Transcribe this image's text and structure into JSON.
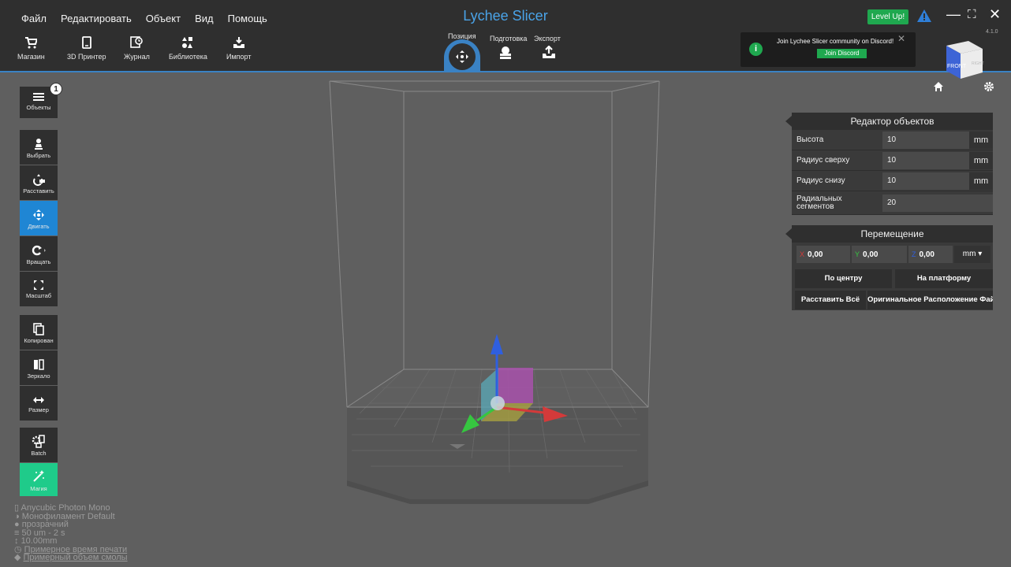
{
  "menu": [
    "Файл",
    "Редактировать",
    "Объект",
    "Вид",
    "Помощь"
  ],
  "app_title": "Lychee Slicer",
  "toolbar": [
    {
      "label": "Магазин",
      "icon": "cart-icon"
    },
    {
      "label": "3D Принтер",
      "icon": "printer-icon"
    },
    {
      "label": "Журнал",
      "icon": "journal-icon"
    },
    {
      "label": "Библиотека",
      "icon": "library-icon"
    },
    {
      "label": "Импорт",
      "icon": "import-icon"
    }
  ],
  "tabs": [
    {
      "label": "Позиция",
      "active": true,
      "icon": "move-icon"
    },
    {
      "label": "Подготовка",
      "active": false,
      "icon": "support-icon"
    },
    {
      "label": "Экспорт",
      "active": false,
      "icon": "export-icon"
    }
  ],
  "level_up": "Level Up!",
  "version": "4.1.0",
  "toast": {
    "message": "Join Lychee Slicer community on Discord!",
    "button": "Join Discord",
    "close": "✕"
  },
  "viewcube": {
    "front": "FRONT",
    "right": "RIGHT"
  },
  "left_tools": [
    {
      "label": "Объекты",
      "icon": "list-icon",
      "badge": "1"
    },
    {
      "label": "Выбрать",
      "icon": "select-icon"
    },
    {
      "label": "Расставить",
      "icon": "arrange-icon"
    },
    {
      "label": "Двигать",
      "icon": "move-icon",
      "active": true
    },
    {
      "label": "Вращать",
      "icon": "rotate-icon"
    },
    {
      "label": "Масштаб",
      "icon": "scale-icon"
    },
    {
      "label": "Копирован",
      "icon": "copy-icon"
    },
    {
      "label": "Зеркало",
      "icon": "mirror-icon"
    },
    {
      "label": "Размер",
      "icon": "resize-icon"
    },
    {
      "label": "Batch",
      "icon": "batch-icon"
    },
    {
      "label": "Магия",
      "icon": "magic-icon"
    }
  ],
  "info": {
    "printer": "Anycubic Photon Mono",
    "filament": "Монофиламент Default",
    "color": "прозрачний",
    "layer": "50 um - 2 s",
    "height": "10.00mm",
    "print_time": "Примерное время печати",
    "volume": "Примерный объем смолы"
  },
  "object_editor": {
    "title": "Редактор объектов",
    "rows": [
      {
        "label": "Высота",
        "value": "10",
        "unit": "mm"
      },
      {
        "label": "Радиус сверху",
        "value": "10",
        "unit": "mm"
      },
      {
        "label": "Радиус снизу",
        "value": "10",
        "unit": "mm"
      },
      {
        "label": "Радиальных сегментов",
        "value": "20",
        "unit": ""
      }
    ]
  },
  "movement": {
    "title": "Перемещение",
    "x_label": "X",
    "x": "0,00",
    "y_label": "Y",
    "y": "0,00",
    "z_label": "Z",
    "z": "0,00",
    "unit": "mm",
    "center": "По центру",
    "to_platform": "На платформу",
    "arrange_all": "Расставить Всё",
    "original_position": "Оригинальное Расположение Фай"
  },
  "colors": {
    "accent": "#3a82c4",
    "active": "#1f86d4",
    "green": "#1fa84f",
    "magic": "#1fcb8a",
    "x_axis": "#d43a3a",
    "y_axis": "#36c640",
    "z_axis": "#2f5fe0"
  }
}
